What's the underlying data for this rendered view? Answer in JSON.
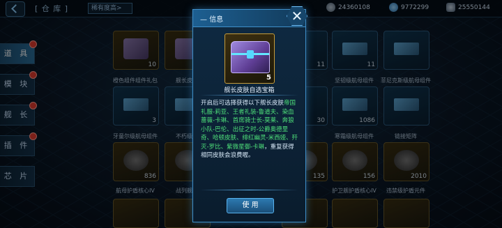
{
  "topbar": {
    "title": "[ 仓 库 ]",
    "filter_label": "稀有度高>",
    "resources": [
      {
        "icon": "metal-icon",
        "value": "24360108"
      },
      {
        "icon": "crystal-icon",
        "value": "9772299"
      },
      {
        "icon": "gas-icon",
        "value": "25550144"
      }
    ]
  },
  "sidebar": {
    "items": [
      {
        "label": "道 具",
        "active": true,
        "badge": true
      },
      {
        "label": "模 块",
        "active": false,
        "badge": true
      },
      {
        "label": "舰 长",
        "active": false,
        "badge": true
      },
      {
        "label": "插 件",
        "active": false,
        "badge": true
      },
      {
        "label": "芯 片",
        "active": false,
        "badge": false
      }
    ]
  },
  "grid": {
    "labels": [
      "橙色组件组件礼包",
      "舰长皮肤",
      "坚韧级航母组件",
      "菲尼克斯级航母组件",
      "牙童尔级航母组件",
      "不朽级航",
      "寒霜级航母组件",
      "链接矩阵",
      "航母护盾核心IV",
      "战列舰护",
      "护卫舰护盾核心IV",
      "违禁级护盾元件"
    ],
    "counts": [
      "10",
      "11",
      "11",
      "3",
      "30",
      "1086",
      "836",
      "135",
      "156",
      "2010"
    ]
  },
  "dialog": {
    "title": "信息",
    "close_label": "✕",
    "item_name": "舰长皮肤自选宝箱",
    "item_count": "5",
    "desc_prefix": "开启后可选择获得以下舰长皮肤",
    "desc_skins": "帝国礼服-莉亚、王者礼装-鲁道夫、染血蔷薇-卡琳、首席骑士长-莫莱、奔狼小队-巴伦、出征之时-公爵奥德里奇、哈顿皮肤、绯红幽灵-米西娅、歼灭-罗比、紫微星御-卡琳",
    "desc_suffix": "，重复获得相同皮肤会浪费喔。",
    "use_label": "使 用"
  }
}
